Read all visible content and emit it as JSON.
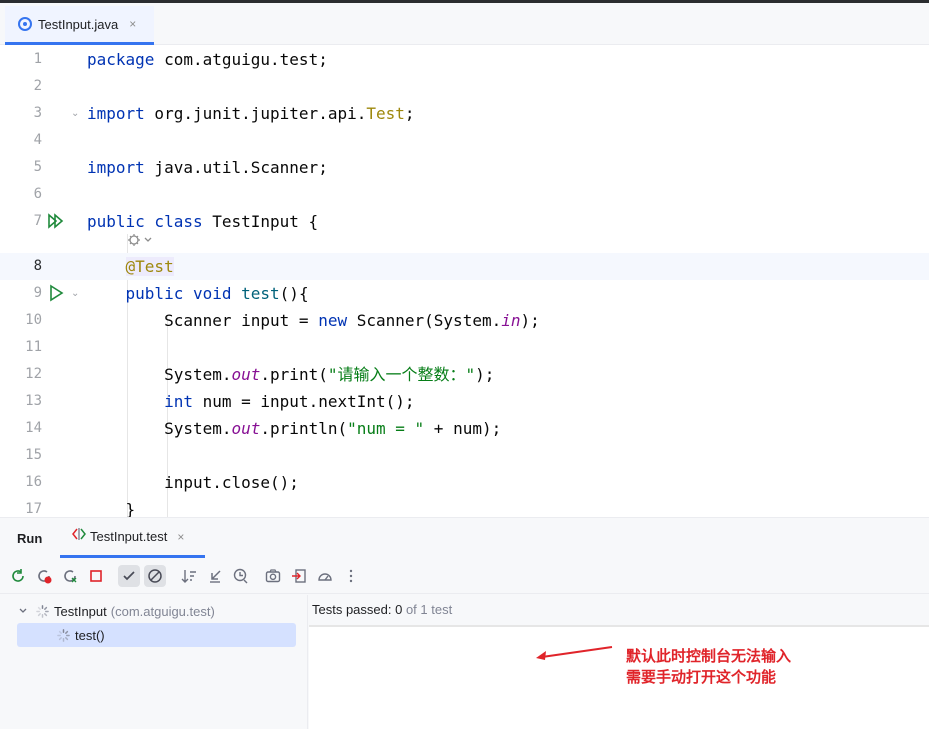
{
  "editor_tab": {
    "label": "TestInput.java",
    "close": "×"
  },
  "code_lines": [
    {
      "n": "1",
      "html": "<span class=\"kw\">package</span> com.atguigu.test;"
    },
    {
      "n": "2",
      "html": ""
    },
    {
      "n": "3",
      "html": "<span class=\"kw\">import</span> org.junit.jupiter.api.<span class=\"ann\">Test</span>;"
    },
    {
      "n": "4",
      "html": ""
    },
    {
      "n": "5",
      "html": "<span class=\"kw\">import</span> java.util.Scanner;"
    },
    {
      "n": "6",
      "html": ""
    },
    {
      "n": "7",
      "html": "<span class=\"kw\">public class</span> TestInput {"
    },
    {
      "n": "8",
      "html": "    <span class=\"ann hlbg\">@Test</span>"
    },
    {
      "n": "9",
      "html": "    <span class=\"kw\">public void</span> <span class=\"mth\">test</span>(){"
    },
    {
      "n": "10",
      "html": "        Scanner input = <span class=\"kw\">new</span> Scanner(System.<span class=\"fld\">in</span>);"
    },
    {
      "n": "11",
      "html": ""
    },
    {
      "n": "12",
      "html": "        System.<span class=\"fld\">out</span>.print(<span class=\"str\">\"请输入一个整数：\"</span>);"
    },
    {
      "n": "13",
      "html": "        <span class=\"kw\">int</span> num = input.nextInt();"
    },
    {
      "n": "14",
      "html": "        System.<span class=\"fld\">out</span>.println(<span class=\"str\">\"num = \"</span> + num);"
    },
    {
      "n": "15",
      "html": ""
    },
    {
      "n": "16",
      "html": "        input.close();"
    },
    {
      "n": "17",
      "html": "    }"
    }
  ],
  "run_panel": {
    "title": "Run",
    "tab_label": "TestInput.test",
    "tab_close": "×",
    "tree": {
      "class_label": "TestInput",
      "class_package": "(com.atguigu.test)",
      "method_label": "test()"
    },
    "status": {
      "prefix": "Tests passed: ",
      "count": "0",
      "suffix": " of 1 test"
    }
  },
  "annotation_note": {
    "line1": "默认此时控制台无法输入",
    "line2": "需要手动打开这个功能"
  },
  "colors": {
    "accent": "#3574f0",
    "run_green": "#208a3c",
    "note_red": "#e0242a"
  }
}
